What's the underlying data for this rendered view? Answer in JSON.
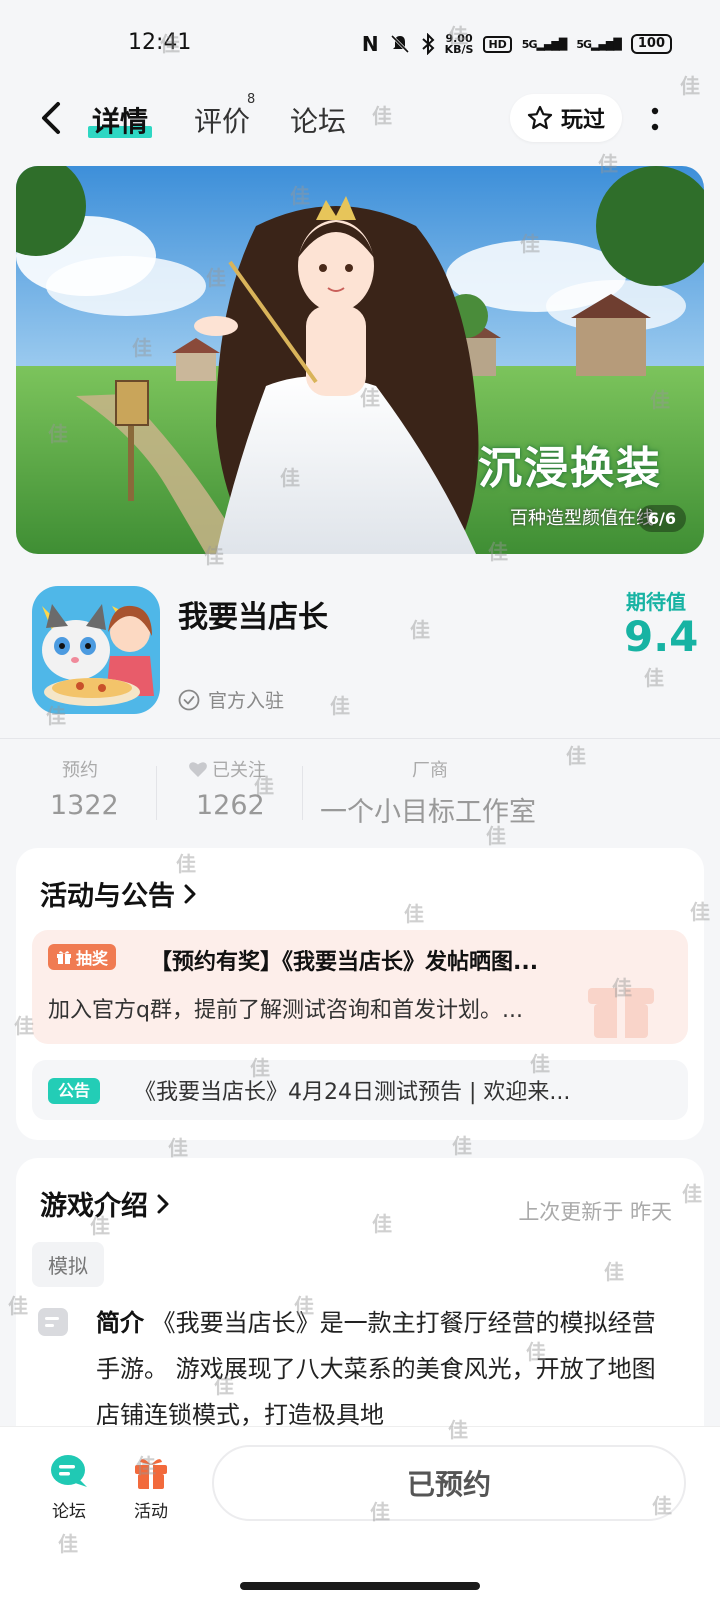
{
  "status_bar": {
    "time": "12:41",
    "net_speed_value": "9.00",
    "net_speed_unit": "KB/S",
    "hd_label": "HD",
    "signal_1": "5G",
    "signal_2": "5G",
    "battery": "100"
  },
  "header": {
    "tabs": [
      {
        "label": "详情",
        "active": true
      },
      {
        "label": "评价",
        "badge": "8"
      },
      {
        "label": "论坛"
      }
    ],
    "play_button_label": "玩过"
  },
  "banner": {
    "headline": "沉浸换装",
    "subline": "百种造型颜值在线",
    "counter": "6/6"
  },
  "game": {
    "title": "我要当店长",
    "official_label": "官方入驻",
    "expect_label": "期待值",
    "expect_value": "9.4"
  },
  "stats": [
    {
      "label": "预约",
      "value": "1322"
    },
    {
      "label": "已关注",
      "value": "1262"
    },
    {
      "label": "厂商",
      "value": "一个小目标工作室"
    }
  ],
  "activity": {
    "title": "活动与公告",
    "promo": {
      "tag": "抽奖",
      "title": "【预约有奖】《我要当店长》发帖晒图...",
      "desc": "加入官方q群，提前了解测试咨询和首发计划。..."
    },
    "notice": {
      "tag": "公告",
      "text": "《我要当店长》4月24日测试预告 | 欢迎来..."
    }
  },
  "intro": {
    "title": "游戏介绍",
    "updated": "上次更新于 昨天",
    "tag": "模拟",
    "label": "简介",
    "text": "《我要当店长》是一款主打餐厅经营的模拟经营手游。 游戏展现了八大菜系的美食风光，开放了地图店铺连锁模式，打造极具地"
  },
  "bottom": {
    "nav": [
      {
        "label": "论坛"
      },
      {
        "label": "活动"
      }
    ],
    "reserve_button": "已预约"
  },
  "watermark": "佳",
  "colors": {
    "accent": "#17b3a3",
    "tab_highlight": "#2ed7c3",
    "promo_bg": "#fdeeea",
    "promo_tag": "#f07b52",
    "notice_tag": "#23cdb6"
  }
}
